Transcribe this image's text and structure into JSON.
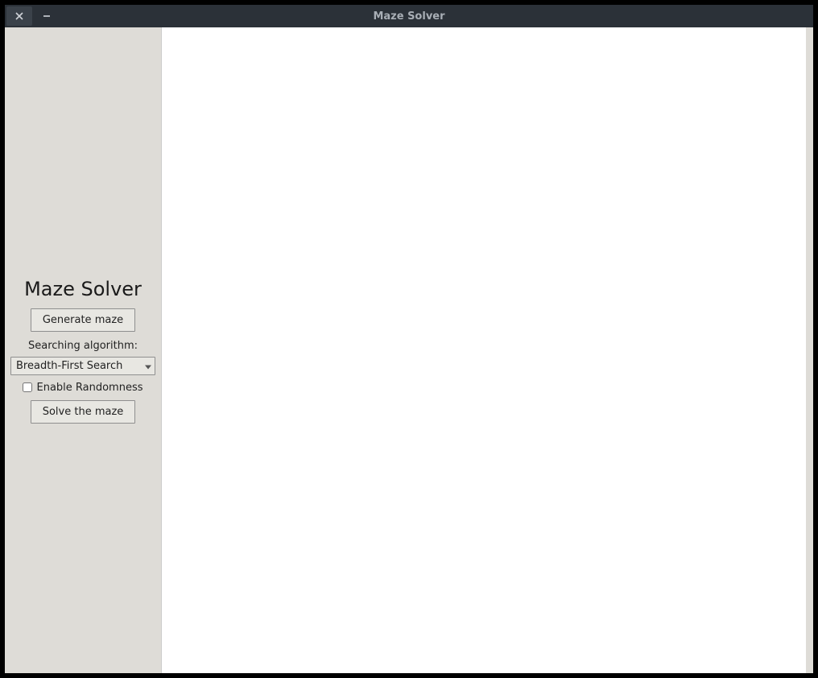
{
  "window": {
    "title": "Maze Solver"
  },
  "sidebar": {
    "app_title": "Maze Solver",
    "generate_button": "Generate maze",
    "algorithm_label": "Searching algorithm:",
    "algorithm_selected": "Breadth-First Search",
    "enable_randomness_label": "Enable Randomness",
    "enable_randomness_checked": false,
    "solve_button": "Solve the maze"
  }
}
